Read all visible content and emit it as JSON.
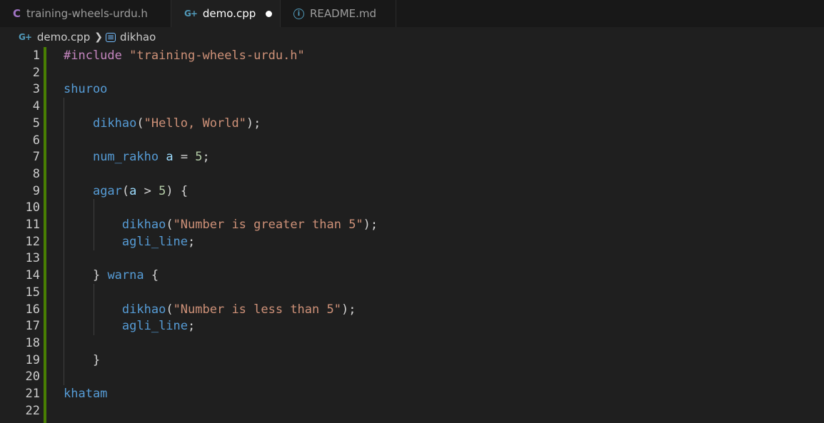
{
  "tabs": [
    {
      "label": "training-wheels-urdu.h",
      "icon": "c-header-icon",
      "active": false
    },
    {
      "label": "demo.cpp",
      "icon": "cpp-file-icon",
      "active": true,
      "dirty": true
    },
    {
      "label": "README.md",
      "icon": "info-icon",
      "active": false
    }
  ],
  "breadcrumb": {
    "file": "demo.cpp",
    "symbol": "dikhao"
  },
  "editor": {
    "line_numbers": [
      "1",
      "2",
      "3",
      "4",
      "5",
      "6",
      "7",
      "8",
      "9",
      "10",
      "11",
      "12",
      "13",
      "14",
      "15",
      "16",
      "17",
      "18",
      "19",
      "20",
      "21",
      "22"
    ],
    "lines": [
      [
        {
          "t": "#include",
          "c": "kw-pre"
        },
        {
          "t": " ",
          "c": "punc"
        },
        {
          "t": "\"training-wheels-urdu.h\"",
          "c": "str"
        }
      ],
      [],
      [
        {
          "t": "shuroo",
          "c": "fn"
        }
      ],
      [],
      [
        {
          "t": "    ",
          "c": "punc"
        },
        {
          "t": "dikhao",
          "c": "call"
        },
        {
          "t": "(",
          "c": "punc"
        },
        {
          "t": "\"Hello, World\"",
          "c": "str"
        },
        {
          "t": ");",
          "c": "punc"
        }
      ],
      [],
      [
        {
          "t": "    ",
          "c": "punc"
        },
        {
          "t": "num_rakho",
          "c": "call"
        },
        {
          "t": " ",
          "c": "punc"
        },
        {
          "t": "a",
          "c": "var"
        },
        {
          "t": " = ",
          "c": "punc"
        },
        {
          "t": "5",
          "c": "num"
        },
        {
          "t": ";",
          "c": "punc"
        }
      ],
      [],
      [
        {
          "t": "    ",
          "c": "punc"
        },
        {
          "t": "agar",
          "c": "call"
        },
        {
          "t": "(",
          "c": "punc"
        },
        {
          "t": "a",
          "c": "var"
        },
        {
          "t": " > ",
          "c": "punc"
        },
        {
          "t": "5",
          "c": "num"
        },
        {
          "t": ") {",
          "c": "punc"
        }
      ],
      [],
      [
        {
          "t": "        ",
          "c": "punc"
        },
        {
          "t": "dikhao",
          "c": "call"
        },
        {
          "t": "(",
          "c": "punc"
        },
        {
          "t": "\"Number is greater than 5\"",
          "c": "str"
        },
        {
          "t": ");",
          "c": "punc"
        }
      ],
      [
        {
          "t": "        ",
          "c": "punc"
        },
        {
          "t": "agli_line",
          "c": "call"
        },
        {
          "t": ";",
          "c": "punc"
        }
      ],
      [],
      [
        {
          "t": "    ",
          "c": "punc"
        },
        {
          "t": "} ",
          "c": "punc"
        },
        {
          "t": "warna",
          "c": "call"
        },
        {
          "t": " {",
          "c": "punc"
        }
      ],
      [],
      [
        {
          "t": "        ",
          "c": "punc"
        },
        {
          "t": "dikhao",
          "c": "call"
        },
        {
          "t": "(",
          "c": "punc"
        },
        {
          "t": "\"Number is less than 5\"",
          "c": "str"
        },
        {
          "t": ");",
          "c": "punc"
        }
      ],
      [
        {
          "t": "        ",
          "c": "punc"
        },
        {
          "t": "agli_line",
          "c": "call"
        },
        {
          "t": ";",
          "c": "punc"
        }
      ],
      [],
      [
        {
          "t": "    ",
          "c": "punc"
        },
        {
          "t": "}",
          "c": "punc"
        }
      ],
      [],
      [
        {
          "t": "khatam",
          "c": "fn"
        }
      ],
      []
    ]
  },
  "colors": {
    "editor_bg": "#1f1f1f",
    "tabbar_bg": "#181818",
    "modified_gutter": "#487e02",
    "keyword_preprocessor": "#c586c0",
    "string": "#ce9178",
    "function": "#569cd6",
    "number": "#b5cea8",
    "variable": "#9cdcfe"
  }
}
